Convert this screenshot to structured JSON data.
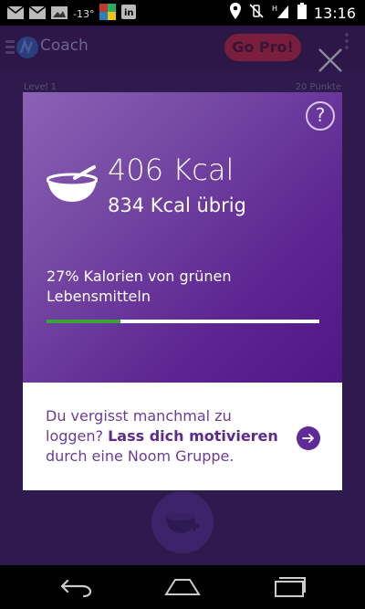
{
  "status_bar": {
    "temperature": "-13°",
    "time": "13:16",
    "icons": [
      "mail-icon",
      "mail-icon",
      "image-icon",
      "weather-icon",
      "app-icon",
      "linkedin-icon",
      "location-icon",
      "vibrate-icon",
      "signal-icon",
      "battery-icon"
    ]
  },
  "app": {
    "title": "Coach",
    "go_pro_label": "Go Pro!",
    "level_label": "Level 1",
    "points_label": "20 Punkte"
  },
  "dialog": {
    "help_label": "?",
    "calories_consumed": "406 Kcal",
    "calories_remaining": "834 Kcal übrig",
    "green_food_text": "27% Kalorien von grünen Lebensmitteln",
    "green_food_percent": 27,
    "motivate_text_part1": "Du vergisst manchmal zu loggen? ",
    "motivate_text_bold": "Lass dich motivieren",
    "motivate_text_part2": " durch eine Noom Gruppe."
  },
  "colors": {
    "accent": "#5f2b96",
    "progress_green": "#3aa43b"
  }
}
